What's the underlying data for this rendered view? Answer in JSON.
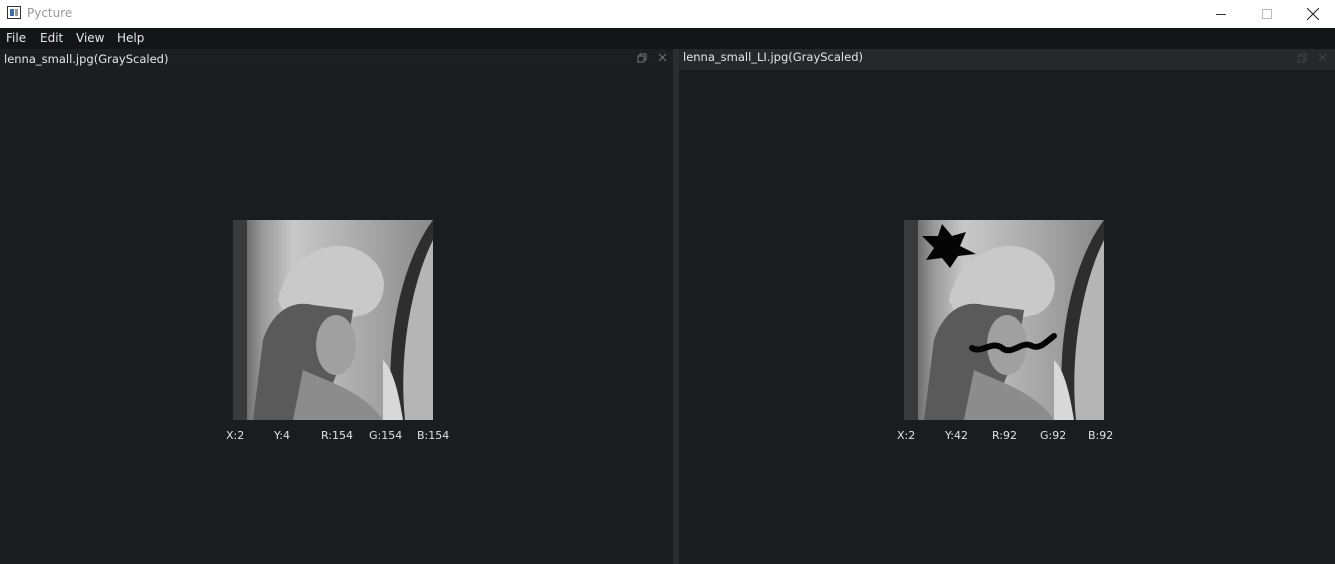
{
  "window": {
    "title": "Pycture"
  },
  "menu": {
    "items": [
      "File",
      "Edit",
      "View",
      "Help"
    ]
  },
  "left_panel": {
    "title": "lenna_small.jpg(GrayScaled)",
    "pixel_info": {
      "x": "X:2",
      "y": "Y:4",
      "r": "R:154",
      "g": "G:154",
      "b": "B:154"
    }
  },
  "right_panel": {
    "title": "lenna_small_LI.jpg(GrayScaled)",
    "pixel_info": {
      "x": "X:2",
      "y": "Y:42",
      "r": "R:92",
      "g": "G:92",
      "b": "B:92"
    }
  },
  "icons": {
    "undock": "restore-icon",
    "close": "close-icon"
  },
  "colors": {
    "background": "#1b1c1e",
    "menubar": "#141516",
    "text": "#e6e6e6"
  }
}
